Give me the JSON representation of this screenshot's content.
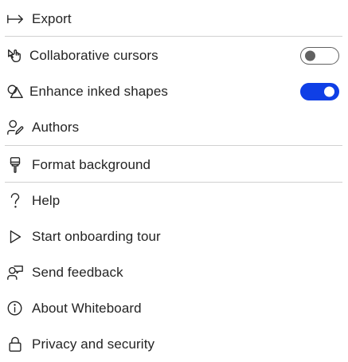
{
  "menu": {
    "items": [
      {
        "label": "Export",
        "icon": "export-arrow-icon"
      },
      {
        "label": "Collaborative cursors",
        "icon": "collaborative-cursors-icon",
        "toggle": "off"
      },
      {
        "label": "Enhance inked shapes",
        "icon": "shapes-icon",
        "toggle": "on"
      },
      {
        "label": "Authors",
        "icon": "authors-icon"
      },
      {
        "label": "Format background",
        "icon": "format-background-icon"
      },
      {
        "label": "Help",
        "icon": "question-mark-icon"
      },
      {
        "label": "Start onboarding tour",
        "icon": "play-icon"
      },
      {
        "label": "Send feedback",
        "icon": "feedback-icon"
      },
      {
        "label": "About Whiteboard",
        "icon": "info-icon"
      },
      {
        "label": "Privacy and security",
        "icon": "lock-icon"
      }
    ]
  },
  "colors": {
    "toggle_on": "#0f3fe6",
    "toggle_off_border": "#616161",
    "text": "#242424",
    "divider": "#d1d1d1"
  }
}
